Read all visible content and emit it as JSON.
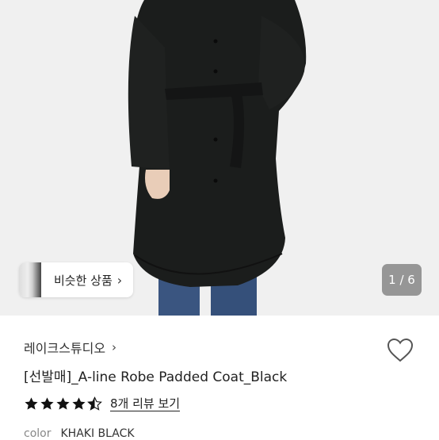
{
  "gallery": {
    "similar_label": "비슷한 상품",
    "similar_chevron": "›",
    "counter": "1 / 6"
  },
  "product": {
    "shop_name": "레이크스튜디오",
    "shop_chevron": "›",
    "title": "[선발매]_A-line Robe Padded Coat_Black",
    "rating": 4.5,
    "review_link": "8개 리뷰 보기",
    "color_label": "color",
    "color_value": "KHAKI BLACK"
  },
  "colors": {
    "coat": "#1b1d1c",
    "jeans": "#3a5580",
    "hair": "#b8916a",
    "skin": "#e9cdb8",
    "star": "#111111"
  }
}
